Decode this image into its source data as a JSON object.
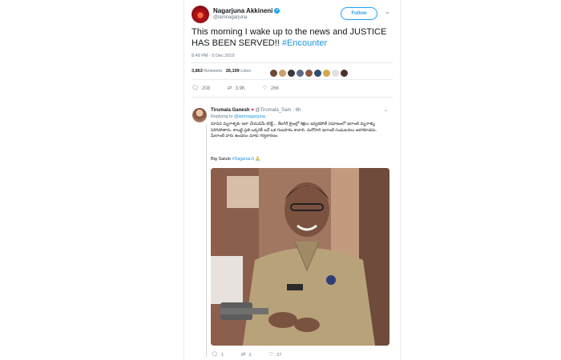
{
  "tweet": {
    "author_name": "Nagarjuna Akkineni",
    "author_handle": "@iamnagarjuna",
    "follow_label": "Follow",
    "text_main": "This morning I wake up to the news and JUSTICE HAS BEEN SERVED!! ",
    "hashtag": "#Encounter",
    "timestamp": "8:49 PM - 5 Dec 2019",
    "retweets_count": "3,863",
    "retweets_label": "Retweets",
    "likes_count": "26,199",
    "likes_label": "Likes",
    "replies_action": "208",
    "retweets_action": "3.9K",
    "likes_action": "26K",
    "liker_colors": [
      "#6b4a3a",
      "#c9a06a",
      "#3a3a3a",
      "#5b6e86",
      "#8b5a3c",
      "#2f4f6f",
      "#d4a84a",
      "#e0e0e0",
      "#4a3328"
    ]
  },
  "reply": {
    "author_name": "Tirumala Ganesh",
    "author_handle": "@Tirumala_Sam",
    "time": "· 6h",
    "replying_to_label": "Replying to",
    "replying_to_handle": "@iamnagarjuna",
    "text": "మానవ మృగాళ్ళకు ఇలా చేయడమే కరెక్ట్... కేటగిరీ క్రైంల్లో శిక్షలు ఇవ్వకపోతే సమాజంలో ఇలాంటి మృగాళ్ళు పెరిగిపోతారు. కాబట్టి ప్రతి ఒక్కరికీ ఇదే ఒక గుణపాఠం కావాలి. మరోసారి ఇలాంటి సంఘటనలు జరగకూడదు. మీలాంటి వారు ఉండటం మాకు గర్వకారణం.",
    "salute_text": "Big Salute ",
    "salute_hashtag": "#SajjanarJi",
    "salute_emoji": "🙏",
    "replies_action": "1",
    "retweets_action": "3",
    "likes_action": "27"
  },
  "icons": {
    "verified": "verified-badge-icon",
    "caret": "chevron-down-icon",
    "reply": "reply-icon",
    "retweet": "retweet-icon",
    "like": "heart-icon"
  },
  "colors": {
    "accent": "#1da1f2",
    "hashtag": "#1b95e0",
    "like": "#e0245e",
    "muted": "#657786"
  }
}
